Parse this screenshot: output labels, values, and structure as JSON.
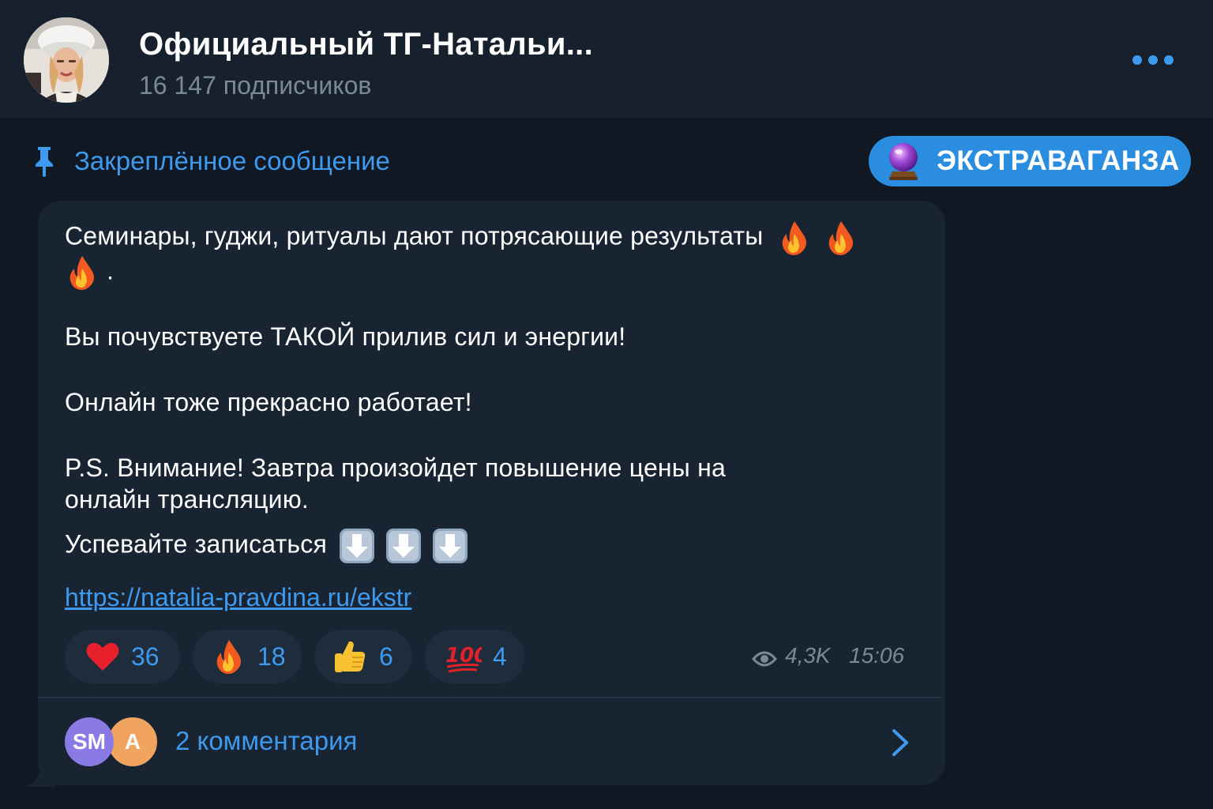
{
  "header": {
    "title": "Официальный ТГ-Натальи...",
    "subscribers": "16 147 подписчиков",
    "avatar_icon": "channel-avatar-icon",
    "more_icon": "more-dots-icon"
  },
  "pinned": {
    "label": "Закреплённое сообщение",
    "icon": "pin-icon"
  },
  "extra_button": {
    "label": "ЭКСТРАВАГАНЗА",
    "icon": "crystal-ball-icon"
  },
  "message": {
    "line1": "Семинары, гуджи, ритуалы дают потрясающие результаты",
    "line1_end": ".",
    "line2": "Вы почувствуете ТАКОЙ прилив сил и энергии!",
    "line3": "Онлайн тоже прекрасно работает!",
    "line4": "P.S. Внимание! Завтра произойдет повышение цены на",
    "line5": "онлайн трансляцию.",
    "line6": "Успевайте записаться",
    "link": "https://natalia-pravdina.ru/ekstr"
  },
  "reactions": [
    {
      "icon": "heart-icon",
      "count": "36"
    },
    {
      "icon": "fire-icon",
      "count": "18"
    },
    {
      "icon": "thumbs-up-icon",
      "count": "6"
    },
    {
      "icon": "hundred-icon",
      "count": "4"
    }
  ],
  "meta": {
    "views": "4,3K",
    "time": "15:06",
    "views_icon": "eye-icon"
  },
  "comments": {
    "label": "2 комментария",
    "avatars": [
      "SM",
      "A"
    ],
    "chevron_icon": "chevron-right-icon"
  },
  "colors": {
    "accent": "#3d9aef",
    "background": "#0f1823",
    "header_bg": "#17212d",
    "bubble_bg": "#192432",
    "button_bg": "#2a8de0"
  }
}
